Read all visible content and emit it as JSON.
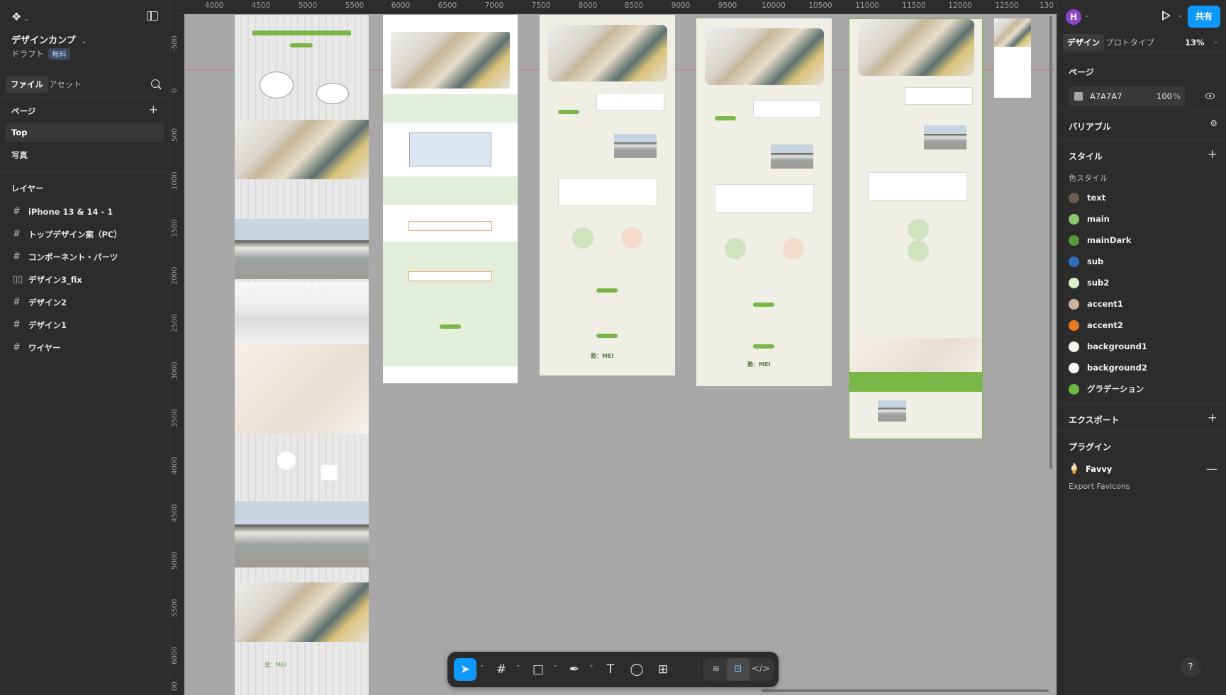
{
  "file": {
    "title": "デザインカンプ",
    "status": "ドラフト",
    "plan_badge": "無料"
  },
  "left_tabs": {
    "file": "ファイル",
    "assets": "アセット"
  },
  "pages": {
    "heading": "ページ",
    "items": [
      "Top",
      "写真"
    ]
  },
  "layers": {
    "heading": "レイヤー",
    "items": [
      {
        "label": "iPhone 13 & 14 - 1",
        "icon": "frame-icon"
      },
      {
        "label": "トップデザイン案（PC）",
        "icon": "frame-icon"
      },
      {
        "label": "コンポーネント・パーツ",
        "icon": "frame-icon"
      },
      {
        "label": "デザイン3_fix",
        "icon": "auto-layout-icon"
      },
      {
        "label": "デザイン2",
        "icon": "frame-icon"
      },
      {
        "label": "デザイン1",
        "icon": "frame-icon"
      },
      {
        "label": "ワイヤー",
        "icon": "frame-icon"
      }
    ]
  },
  "ruler": {
    "x_ticks": [
      "4000",
      "4500",
      "5000",
      "5500",
      "6000",
      "6500",
      "7000",
      "7500",
      "8000",
      "8500",
      "9000",
      "9500",
      "10000",
      "10500",
      "11000",
      "11500",
      "12000",
      "12500",
      "130"
    ],
    "y_ticks": [
      "-500",
      "0",
      "500",
      "1000",
      "1500",
      "2000",
      "2500",
      "3000",
      "3500",
      "4000",
      "4500",
      "5000",
      "5500",
      "6000",
      "00"
    ]
  },
  "canvas_text": {
    "mei_logo": "塾：MEI"
  },
  "toolbar": {
    "tools": [
      "move-tool",
      "frame-tool",
      "shape-tool",
      "pen-tool",
      "text-tool",
      "comment-tool",
      "actions-tool"
    ],
    "modes": [
      "draw-mode",
      "design-mode",
      "dev-mode"
    ]
  },
  "right": {
    "avatar_letter": "H",
    "share_label": "共有",
    "tabs": {
      "design": "デザイン",
      "prototype": "プロトタイプ"
    },
    "zoom": "13%",
    "page_section": {
      "heading": "ページ",
      "fill_hex": "A7A7A7",
      "opacity": "100",
      "opacity_unit": "%",
      "swatch_color": "#A7A7A7"
    },
    "variables_heading": "バリアブル",
    "styles_heading": "スタイル",
    "color_styles_label": "色スタイル",
    "color_styles": [
      {
        "name": "text",
        "color": "#6b5b52"
      },
      {
        "name": "main",
        "color": "#8dc66b"
      },
      {
        "name": "mainDark",
        "color": "#5a9a3a"
      },
      {
        "name": "sub",
        "color": "#2f6fbd"
      },
      {
        "name": "sub2",
        "color": "#d8f0c8"
      },
      {
        "name": "accent1",
        "color": "#c9b3a0"
      },
      {
        "name": "accent2",
        "color": "#e87a24"
      },
      {
        "name": "background1",
        "color": "#f4f7ef"
      },
      {
        "name": "background2",
        "color": "#fafafa"
      },
      {
        "name": "グラデーション",
        "color": "#6cb83f"
      }
    ],
    "export_heading": "エクスポート",
    "plugins_heading": "プラグイン",
    "plugin": {
      "name": "Favvy",
      "subtitle": "Export Favicons"
    },
    "help": "?"
  }
}
